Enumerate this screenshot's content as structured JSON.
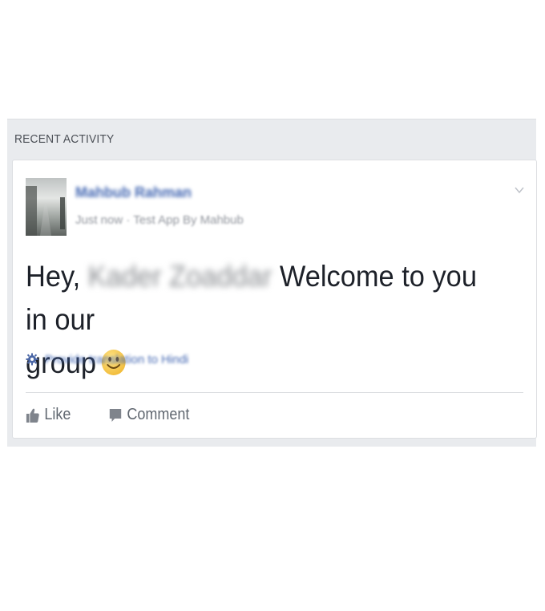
{
  "panel": {
    "header": "RECENT ACTIVITY"
  },
  "post": {
    "author": "Mahbub Rahman",
    "meta": "Just now · Test App By Mahbub",
    "message": {
      "greeting": "Hey,",
      "mentioned_name": "Kader Zoaddar",
      "text_line1": "Welcome to you in our",
      "text_line2": "group"
    },
    "translation_link": "Provide translation to Hindi",
    "emoji": "smiley-face",
    "colors": {
      "link": "#4367b2",
      "text": "#1d2129",
      "muted": "#90949c",
      "panel_bg": "#e9ebee"
    }
  },
  "actions": {
    "like_label": "Like",
    "comment_label": "Comment"
  }
}
